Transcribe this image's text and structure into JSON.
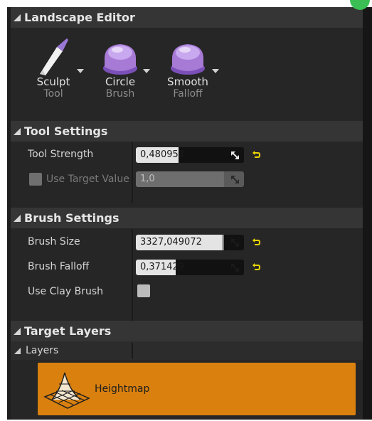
{
  "sections": {
    "landscape_editor": "Landscape Editor",
    "tool_settings": "Tool Settings",
    "brush_settings": "Brush Settings",
    "target_layers": "Target Layers"
  },
  "tools": [
    {
      "label": "Sculpt",
      "sub": "Tool",
      "icon": "brush-pen-icon"
    },
    {
      "label": "Circle",
      "sub": "Brush",
      "icon": "circle-brush-icon"
    },
    {
      "label": "Smooth",
      "sub": "Falloff",
      "icon": "smooth-falloff-icon"
    }
  ],
  "tool_settings": {
    "tool_strength_label": "Tool Strength",
    "tool_strength_value": "0,480953",
    "tool_strength_fraction": 0.48,
    "use_target_value_label": "Use Target Value",
    "target_value": "1,0",
    "target_value_fraction": 1.0
  },
  "brush_settings": {
    "brush_size_label": "Brush Size",
    "brush_size_value": "3327,049072",
    "brush_size_fraction": 0.8,
    "brush_falloff_label": "Brush Falloff",
    "brush_falloff_value": "0,371429",
    "brush_falloff_fraction": 0.37,
    "use_clay_brush_label": "Use Clay Brush"
  },
  "target_layers": {
    "layers_label": "Layers",
    "layer_name": "Heightmap"
  },
  "colors": {
    "panel_bg": "#262626",
    "header_bg": "#353535",
    "layer_tile": "#d9800f",
    "reset_arrow": "#e8d400",
    "brush_purple": "#a77ad6"
  }
}
